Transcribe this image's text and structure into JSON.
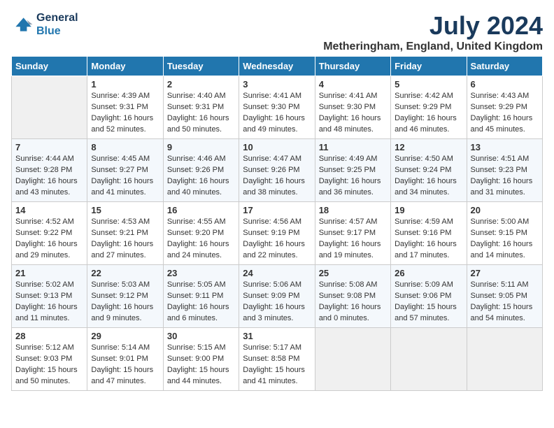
{
  "logo": {
    "line1": "General",
    "line2": "Blue"
  },
  "title": "July 2024",
  "location": "Metheringham, England, United Kingdom",
  "days_of_week": [
    "Sunday",
    "Monday",
    "Tuesday",
    "Wednesday",
    "Thursday",
    "Friday",
    "Saturday"
  ],
  "weeks": [
    [
      {
        "day": "",
        "sunrise": "",
        "sunset": "",
        "daylight": "",
        "empty": true
      },
      {
        "day": "1",
        "sunrise": "4:39 AM",
        "sunset": "9:31 PM",
        "daylight": "16 hours and 52 minutes."
      },
      {
        "day": "2",
        "sunrise": "4:40 AM",
        "sunset": "9:31 PM",
        "daylight": "16 hours and 50 minutes."
      },
      {
        "day": "3",
        "sunrise": "4:41 AM",
        "sunset": "9:30 PM",
        "daylight": "16 hours and 49 minutes."
      },
      {
        "day": "4",
        "sunrise": "4:41 AM",
        "sunset": "9:30 PM",
        "daylight": "16 hours and 48 minutes."
      },
      {
        "day": "5",
        "sunrise": "4:42 AM",
        "sunset": "9:29 PM",
        "daylight": "16 hours and 46 minutes."
      },
      {
        "day": "6",
        "sunrise": "4:43 AM",
        "sunset": "9:29 PM",
        "daylight": "16 hours and 45 minutes."
      }
    ],
    [
      {
        "day": "7",
        "sunrise": "4:44 AM",
        "sunset": "9:28 PM",
        "daylight": "16 hours and 43 minutes."
      },
      {
        "day": "8",
        "sunrise": "4:45 AM",
        "sunset": "9:27 PM",
        "daylight": "16 hours and 41 minutes."
      },
      {
        "day": "9",
        "sunrise": "4:46 AM",
        "sunset": "9:26 PM",
        "daylight": "16 hours and 40 minutes."
      },
      {
        "day": "10",
        "sunrise": "4:47 AM",
        "sunset": "9:26 PM",
        "daylight": "16 hours and 38 minutes."
      },
      {
        "day": "11",
        "sunrise": "4:49 AM",
        "sunset": "9:25 PM",
        "daylight": "16 hours and 36 minutes."
      },
      {
        "day": "12",
        "sunrise": "4:50 AM",
        "sunset": "9:24 PM",
        "daylight": "16 hours and 34 minutes."
      },
      {
        "day": "13",
        "sunrise": "4:51 AM",
        "sunset": "9:23 PM",
        "daylight": "16 hours and 31 minutes."
      }
    ],
    [
      {
        "day": "14",
        "sunrise": "4:52 AM",
        "sunset": "9:22 PM",
        "daylight": "16 hours and 29 minutes."
      },
      {
        "day": "15",
        "sunrise": "4:53 AM",
        "sunset": "9:21 PM",
        "daylight": "16 hours and 27 minutes."
      },
      {
        "day": "16",
        "sunrise": "4:55 AM",
        "sunset": "9:20 PM",
        "daylight": "16 hours and 24 minutes."
      },
      {
        "day": "17",
        "sunrise": "4:56 AM",
        "sunset": "9:19 PM",
        "daylight": "16 hours and 22 minutes."
      },
      {
        "day": "18",
        "sunrise": "4:57 AM",
        "sunset": "9:17 PM",
        "daylight": "16 hours and 19 minutes."
      },
      {
        "day": "19",
        "sunrise": "4:59 AM",
        "sunset": "9:16 PM",
        "daylight": "16 hours and 17 minutes."
      },
      {
        "day": "20",
        "sunrise": "5:00 AM",
        "sunset": "9:15 PM",
        "daylight": "16 hours and 14 minutes."
      }
    ],
    [
      {
        "day": "21",
        "sunrise": "5:02 AM",
        "sunset": "9:13 PM",
        "daylight": "16 hours and 11 minutes."
      },
      {
        "day": "22",
        "sunrise": "5:03 AM",
        "sunset": "9:12 PM",
        "daylight": "16 hours and 9 minutes."
      },
      {
        "day": "23",
        "sunrise": "5:05 AM",
        "sunset": "9:11 PM",
        "daylight": "16 hours and 6 minutes."
      },
      {
        "day": "24",
        "sunrise": "5:06 AM",
        "sunset": "9:09 PM",
        "daylight": "16 hours and 3 minutes."
      },
      {
        "day": "25",
        "sunrise": "5:08 AM",
        "sunset": "9:08 PM",
        "daylight": "16 hours and 0 minutes."
      },
      {
        "day": "26",
        "sunrise": "5:09 AM",
        "sunset": "9:06 PM",
        "daylight": "15 hours and 57 minutes."
      },
      {
        "day": "27",
        "sunrise": "5:11 AM",
        "sunset": "9:05 PM",
        "daylight": "15 hours and 54 minutes."
      }
    ],
    [
      {
        "day": "28",
        "sunrise": "5:12 AM",
        "sunset": "9:03 PM",
        "daylight": "15 hours and 50 minutes."
      },
      {
        "day": "29",
        "sunrise": "5:14 AM",
        "sunset": "9:01 PM",
        "daylight": "15 hours and 47 minutes."
      },
      {
        "day": "30",
        "sunrise": "5:15 AM",
        "sunset": "9:00 PM",
        "daylight": "15 hours and 44 minutes."
      },
      {
        "day": "31",
        "sunrise": "5:17 AM",
        "sunset": "8:58 PM",
        "daylight": "15 hours and 41 minutes."
      },
      {
        "day": "",
        "sunrise": "",
        "sunset": "",
        "daylight": "",
        "empty": true
      },
      {
        "day": "",
        "sunrise": "",
        "sunset": "",
        "daylight": "",
        "empty": true
      },
      {
        "day": "",
        "sunrise": "",
        "sunset": "",
        "daylight": "",
        "empty": true
      }
    ]
  ]
}
